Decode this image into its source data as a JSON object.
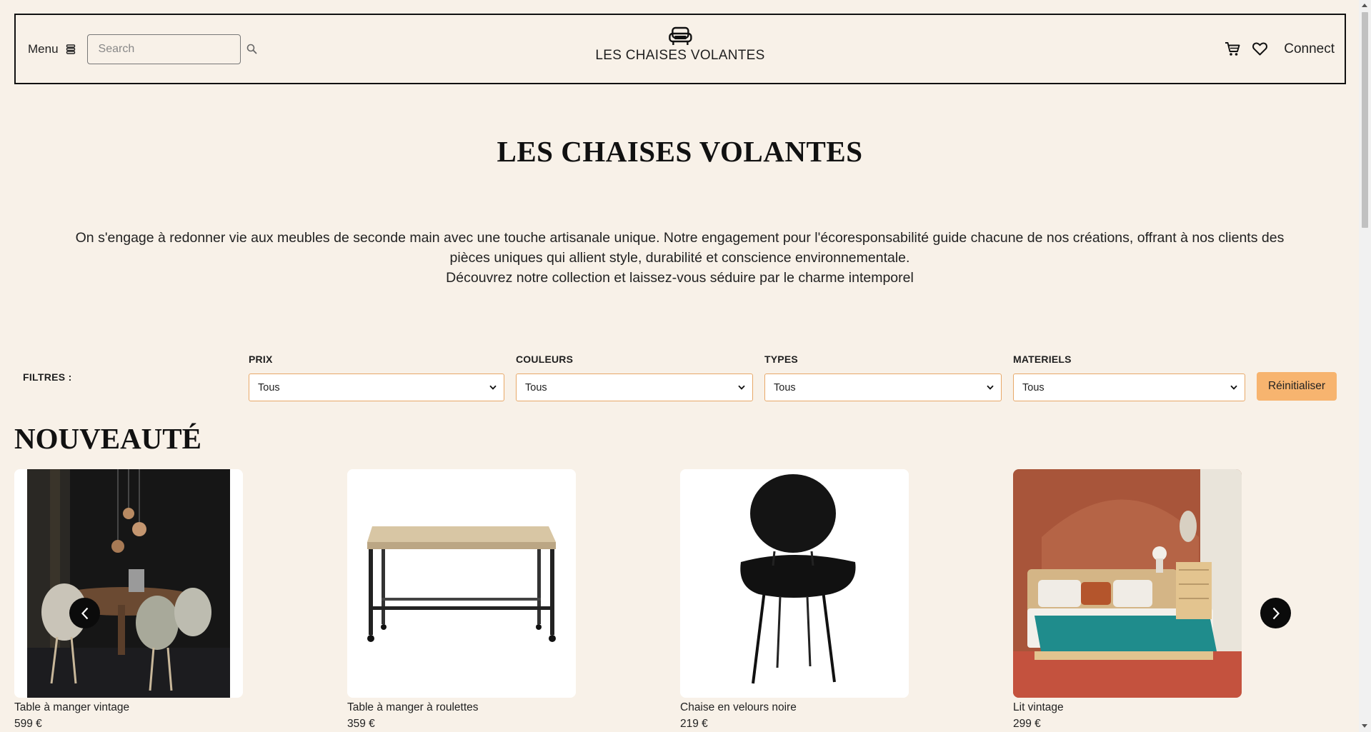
{
  "header": {
    "menu_label": "Menu",
    "menu_icon": "stack-icon",
    "search_placeholder": "Search",
    "search_icon": "magnifier-icon",
    "brand_icon": "armchair-icon",
    "brand_name": "LES CHAISES VOLANTES",
    "cart_icon": "cart-icon",
    "wishlist_icon": "heart-icon",
    "connect_label": "Connect"
  },
  "hero": {
    "title": "LES CHAISES VOLANTES",
    "description_line1": "On s'engage à redonner vie aux meubles de seconde main avec une touche artisanale unique. Notre engagement pour l'écoresponsabilité guide chacune de nos créations, offrant à nos clients des pièces uniques qui allient style, durabilité et conscience environnementale.",
    "description_line2": "Découvrez notre collection et laissez-vous séduire par le charme intemporel"
  },
  "filters": {
    "label": "FILTRES :",
    "prix": {
      "label": "PRIX",
      "value": "Tous"
    },
    "couleurs": {
      "label": "COULEURS",
      "value": "Tous"
    },
    "types": {
      "label": "TYPES",
      "value": "Tous"
    },
    "materiels": {
      "label": "MATERIELS",
      "value": "Tous"
    },
    "reset_label": "Réinitialiser"
  },
  "new_arrivals": {
    "title": "NOUVEAUTÉ",
    "products": [
      {
        "name": "Table à manger vintage",
        "price": "599 €"
      },
      {
        "name": "Table à manger à roulettes",
        "price": "359 €"
      },
      {
        "name": "Chaise en velours noire",
        "price": "219 €"
      },
      {
        "name": "Lit vintage",
        "price": "299 €"
      }
    ]
  },
  "colors": {
    "background": "#f8f1e8",
    "accent": "#f7b46f",
    "select_border": "#e8a868",
    "text": "#1f1f1f"
  }
}
